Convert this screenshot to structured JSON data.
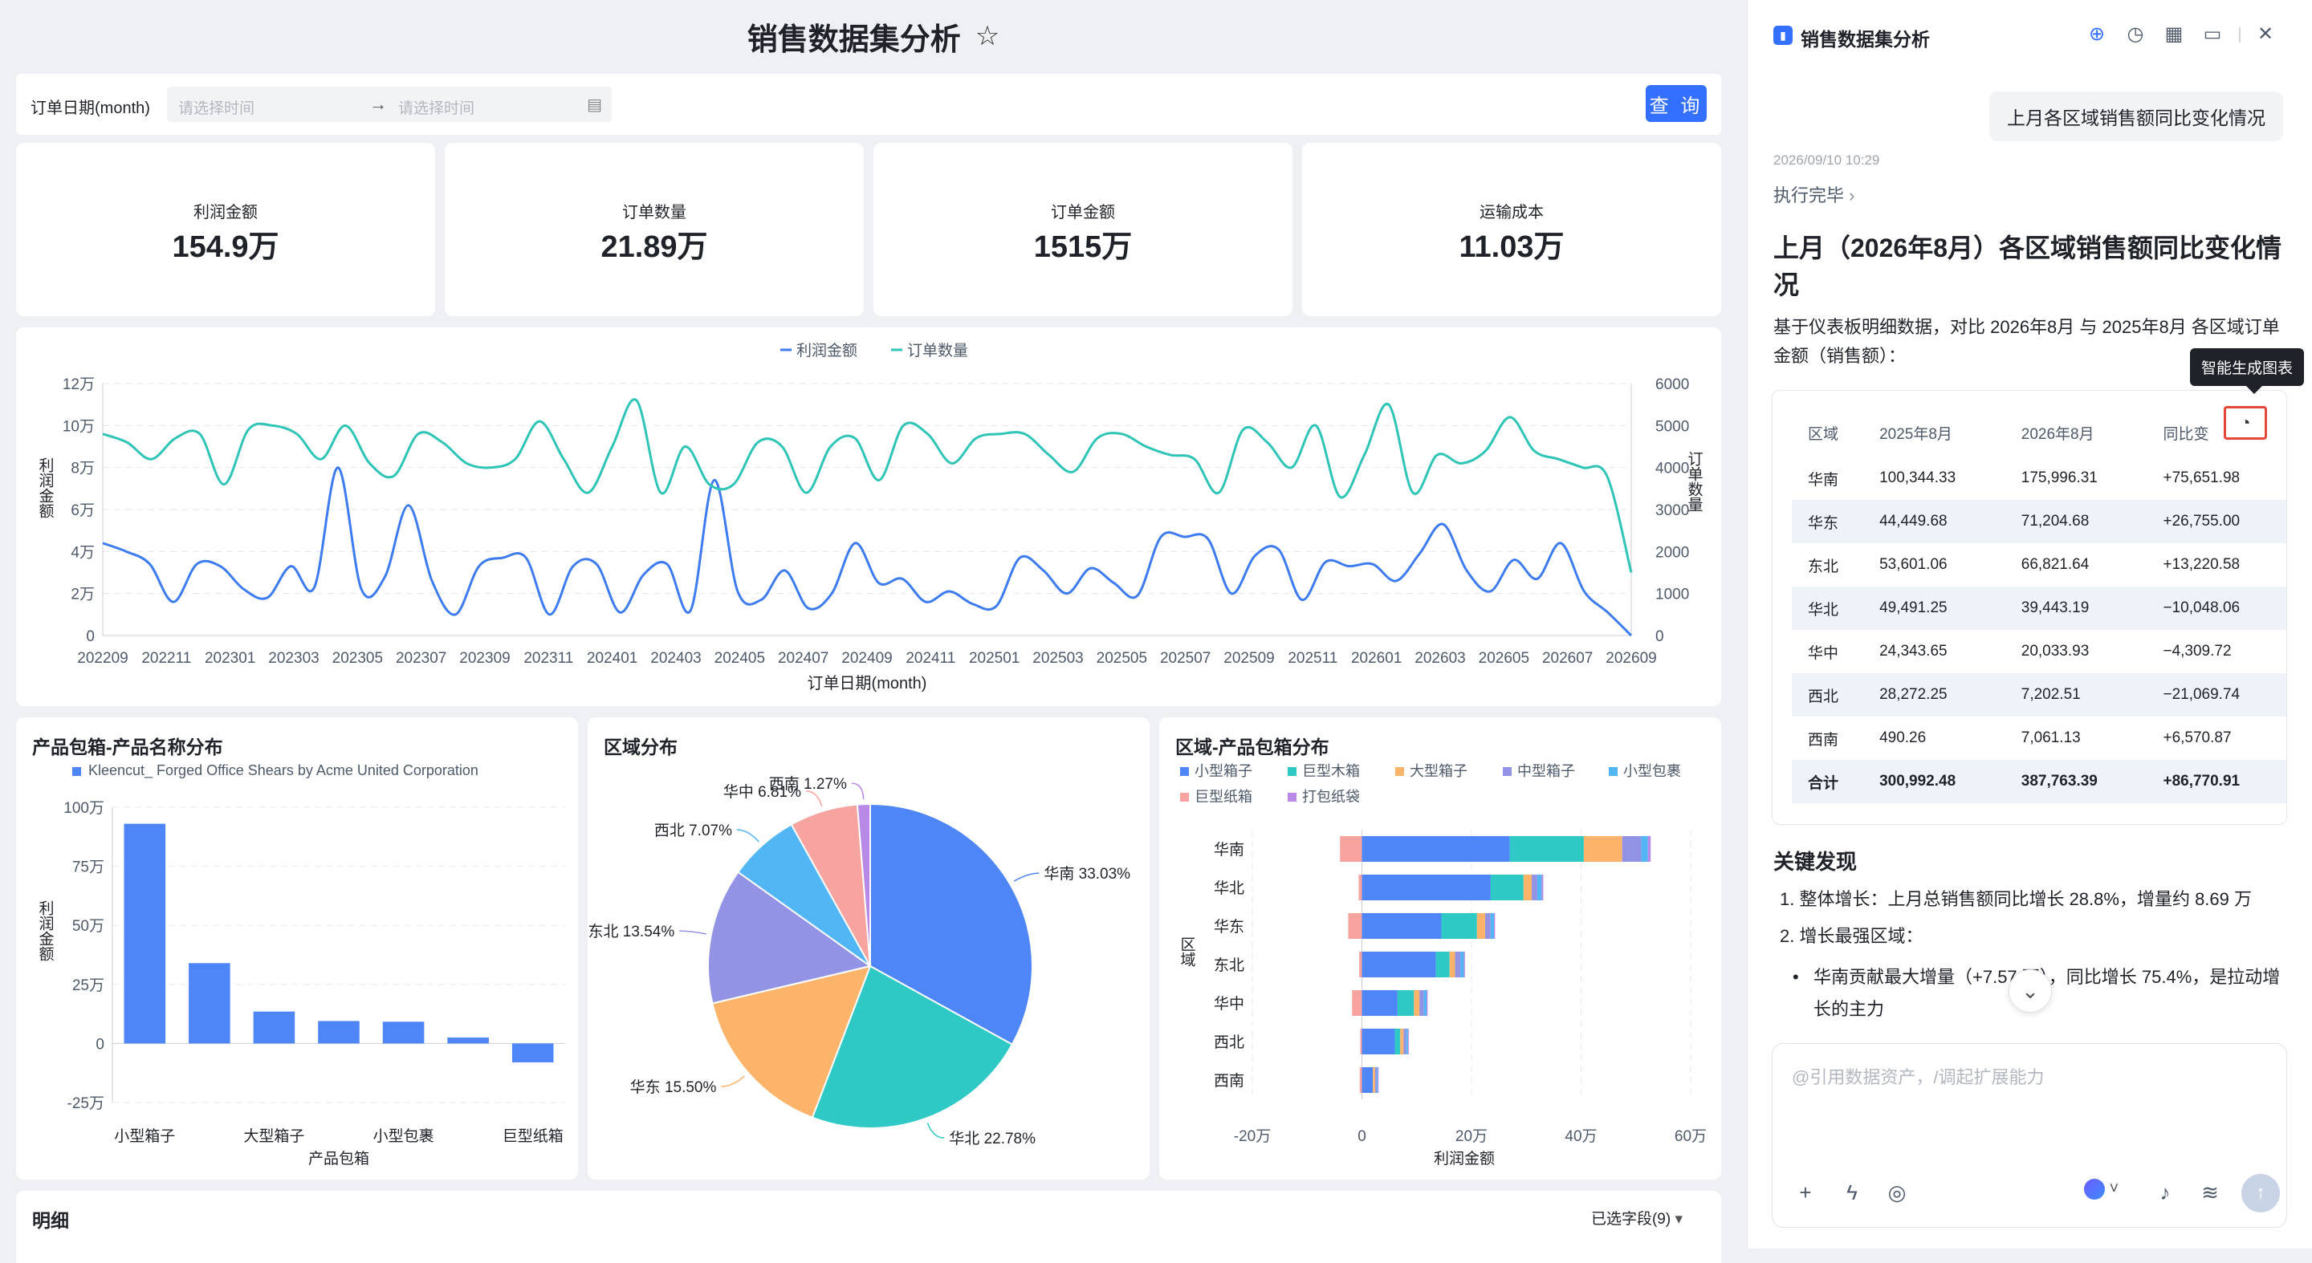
{
  "dashboard": {
    "title": "销售数据集分析",
    "filter": {
      "label": "订单日期(month)",
      "start_placeholder": "请选择时间",
      "end_placeholder": "请选择时间",
      "query_label": "查 询"
    },
    "kpis": [
      {
        "label": "利润金额",
        "value": "154.9万"
      },
      {
        "label": "订单数量",
        "value": "21.89万"
      },
      {
        "label": "订单金额",
        "value": "1515万"
      },
      {
        "label": "运输成本",
        "value": "11.03万"
      }
    ],
    "detail": {
      "title": "明细",
      "fields_label": "已选字段(9)"
    }
  },
  "chart_data": [
    {
      "type": "line",
      "legend": [
        "利润金额",
        "订单数量"
      ],
      "legend_position": "top",
      "xlabel": "订单日期(month)",
      "ylabel": "利润金额",
      "ylabel_right": "订单数量",
      "x_ticks": [
        "202209",
        "202211",
        "202301",
        "202303",
        "202305",
        "202307",
        "202309",
        "202311",
        "202401",
        "202403",
        "202405",
        "202407",
        "202409",
        "202411",
        "202501",
        "202503",
        "202505",
        "202507",
        "202509",
        "202511",
        "202601",
        "202603",
        "202605",
        "202607",
        "202609"
      ],
      "y_ticks_left": [
        "0",
        "2万",
        "4万",
        "6万",
        "8万",
        "10万",
        "12万"
      ],
      "y_ticks_right": [
        "0",
        "1000",
        "2000",
        "3000",
        "4000",
        "5000",
        "6000"
      ],
      "ylim": [
        0,
        120000
      ],
      "ylim_right": [
        0,
        6000
      ],
      "series": [
        {
          "name": "利润金额",
          "axis": "left",
          "color": "#3d7bf0",
          "values": [
            44000,
            40000,
            34000,
            16000,
            34000,
            33000,
            22000,
            18000,
            33000,
            23000,
            80000,
            22000,
            28000,
            62000,
            26000,
            10000,
            33000,
            37000,
            37000,
            10000,
            33000,
            34000,
            11000,
            29000,
            34000,
            12000,
            74000,
            21000,
            17000,
            31000,
            13000,
            20000,
            44000,
            25000,
            27000,
            16000,
            21000,
            15000,
            14000,
            37000,
            31000,
            20000,
            32000,
            25000,
            19000,
            47000,
            47000,
            46000,
            20000,
            38000,
            41000,
            17000,
            35000,
            33000,
            34000,
            26000,
            39000,
            53000,
            31000,
            21000,
            36000,
            27000,
            44000,
            21000,
            11000,
            0
          ]
        },
        {
          "name": "订单数量",
          "axis": "right",
          "color": "#2ec4b6",
          "values": [
            4800,
            4600,
            4200,
            4700,
            4800,
            3600,
            4900,
            5000,
            4800,
            4200,
            5000,
            4100,
            3800,
            4800,
            4600,
            4100,
            4000,
            4200,
            5100,
            4200,
            3400,
            4500,
            5600,
            3400,
            4500,
            3600,
            3600,
            4600,
            4500,
            3400,
            4500,
            4700,
            3700,
            5000,
            4800,
            4100,
            4700,
            4800,
            4800,
            4300,
            3900,
            4700,
            4800,
            4500,
            4300,
            4200,
            3400,
            4900,
            4600,
            4000,
            5000,
            3300,
            4300,
            5500,
            3400,
            4300,
            4100,
            4400,
            5200,
            4400,
            4200,
            4000,
            3800,
            1500
          ]
        }
      ]
    },
    {
      "type": "bar",
      "title": "产品包箱-产品名称分布",
      "legend": [
        "Kleencut_ Forged Office Shears by Acme United Corporation"
      ],
      "xlabel": "产品包箱",
      "ylabel": "利润金额",
      "categories": [
        "小型箱子",
        "",
        "大型箱子",
        "",
        "小型包裹",
        "",
        "巨型纸箱"
      ],
      "visible_categories": [
        "小型箱子",
        "大型箱子",
        "小型包裹",
        "巨型纸箱"
      ],
      "values": [
        930000,
        340000,
        135000,
        95000,
        92000,
        25000,
        -80000
      ],
      "y_ticks": [
        "-25万",
        "0",
        "25万",
        "50万",
        "75万",
        "100万"
      ],
      "ylim": [
        -250000,
        1000000
      ],
      "color": "#4e86f7"
    },
    {
      "type": "pie",
      "title": "区域分布",
      "slices": [
        {
          "label": "华南 33.03%",
          "value": 33.03,
          "color": "#4e86f7"
        },
        {
          "label": "华北 22.78%",
          "value": 22.78,
          "color": "#2ec9c4"
        },
        {
          "label": "华东 15.50%",
          "value": 15.5,
          "color": "#fbb46a"
        },
        {
          "label": "东北 13.54%",
          "value": 13.54,
          "color": "#9393e6"
        },
        {
          "label": "西北 7.07%",
          "value": 7.07,
          "color": "#52b5f4"
        },
        {
          "label": "华中 6.81%",
          "value": 6.81,
          "color": "#f7a3a0"
        },
        {
          "label": "西南 1.27%",
          "value": 1.27,
          "color": "#b889e6"
        }
      ]
    },
    {
      "type": "bar",
      "orientation": "horizontal-stacked",
      "title": "区域-产品包箱分布",
      "xlabel": "利润金额",
      "ylabel": "区域",
      "categories": [
        "华南",
        "华北",
        "华东",
        "东北",
        "华中",
        "西北",
        "西南"
      ],
      "x_ticks": [
        "-20万",
        "0",
        "20万",
        "40万",
        "60万"
      ],
      "xlim": [
        -200000,
        600000
      ],
      "series": [
        {
          "name": "小型箱子",
          "color": "#4e86f7",
          "values": [
            270000,
            235000,
            145000,
            135000,
            65000,
            60000,
            20000
          ]
        },
        {
          "name": "巨型木箱",
          "color": "#2ec9c4",
          "values": [
            135000,
            60000,
            65000,
            25000,
            30000,
            10000,
            0
          ]
        },
        {
          "name": "大型箱子",
          "color": "#fbb46a",
          "values": [
            70000,
            15000,
            15000,
            10000,
            10000,
            6000,
            4000
          ]
        },
        {
          "name": "中型箱子",
          "color": "#9393e6",
          "values": [
            35000,
            10000,
            10000,
            10000,
            8000,
            5000,
            3000
          ]
        },
        {
          "name": "小型包裹",
          "color": "#52b5f4",
          "values": [
            12000,
            8000,
            6000,
            6000,
            5000,
            3000,
            2000
          ]
        },
        {
          "name": "巨型纸箱",
          "color": "#f7a3a0",
          "values": [
            -40000,
            -6000,
            -25000,
            -5000,
            -18000,
            -3000,
            -4000
          ]
        },
        {
          "name": "打包纸袋",
          "color": "#b889e6",
          "values": [
            5000,
            3000,
            2000,
            2000,
            2000,
            1000,
            1000
          ]
        }
      ]
    }
  ],
  "panel": {
    "title": "销售数据集分析",
    "user_message": "上月各区域销售额同比变化情况",
    "timestamp": "2026/09/10 10:29",
    "status": "执行完毕",
    "heading": "上月（2026年8月）各区域销售额同比变化情况",
    "intro": "基于仪表板明细数据，对比 2026年8月 与 2025年8月 各区域订单金额（销售额）：",
    "tooltip": "智能生成图表",
    "table": {
      "headers": [
        "区域",
        "2025年8月",
        "2026年8月",
        "同比变"
      ],
      "rows": [
        [
          "华南",
          "100,344.33",
          "175,996.31",
          "+75,651.98"
        ],
        [
          "华东",
          "44,449.68",
          "71,204.68",
          "+26,755.00"
        ],
        [
          "东北",
          "53,601.06",
          "66,821.64",
          "+13,220.58"
        ],
        [
          "华北",
          "49,491.25",
          "39,443.19",
          "−10,048.06"
        ],
        [
          "华中",
          "24,343.65",
          "20,033.93",
          "−4,309.72"
        ],
        [
          "西北",
          "28,272.25",
          "7,202.51",
          "−21,069.74"
        ],
        [
          "西南",
          "490.26",
          "7,061.13",
          "+6,570.87"
        ]
      ],
      "total": [
        "合计",
        "300,992.48",
        "387,763.39",
        "+86,770.91"
      ]
    },
    "findings_title": "关键发现",
    "finding1": "1. 整体增长：上月总销售额同比增长 28.8%，增量约 8.69 万",
    "finding2": "2. 增长最强区域：",
    "finding3": "华南贡献最大增量（+7.57 万），同比增长 75.4%，是拉动增长的主力",
    "input_placeholder": "@引用数据资产，/调起扩展能力"
  }
}
